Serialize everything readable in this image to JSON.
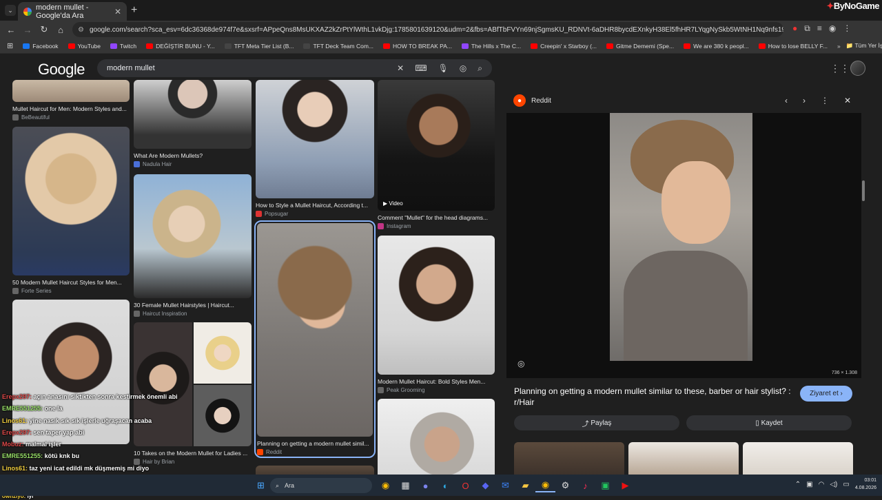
{
  "browser": {
    "tab_title": "modern mullet - Google'da Ara",
    "url": "google.com/search?sca_esv=6dc36368de974f7e&sxsrf=APpeQns8MsUKXAZ2kZrPtYlWthL1vkDjg:1785801639120&udm=2&fbs=ABfTbFVYn69njSgmsKU_RDNVt-6aDHR8bycdEXnkyH38El5fhHR7LYqgNySkb5WtNH1Nq9nfs197E1NJ0R3R...",
    "brand_overlay": "ByNoGame",
    "bookmarks": [
      {
        "label": "Facebook",
        "color": "#1877f2"
      },
      {
        "label": "YouTube",
        "color": "#ff0000"
      },
      {
        "label": "Twitch",
        "color": "#9146ff"
      },
      {
        "label": "DEĞİŞTİR BUNU - Y...",
        "color": "#ff0000"
      },
      {
        "label": "TFT Meta Tier List (B...",
        "color": "#444444"
      },
      {
        "label": "TFT Deck Team Com...",
        "color": "#444444"
      },
      {
        "label": "HOW TO BREAK PA...",
        "color": "#ff0000"
      },
      {
        "label": "The Hills x The C...",
        "color": "#9146ff"
      },
      {
        "label": "Creepin' x Starboy (...",
        "color": "#ff0000"
      },
      {
        "label": "Gitme Dememi (Spe...",
        "color": "#ff0000"
      },
      {
        "label": "We are 380 k peopl...",
        "color": "#ff0000"
      },
      {
        "label": "How to lose BELLY F...",
        "color": "#ff0000"
      }
    ],
    "all_bookmarks_label": "Tüm Yer İşaretleri"
  },
  "google": {
    "logo": "Google",
    "query": "modern mullet"
  },
  "results": {
    "col1": [
      {
        "caption": "Mullet Haircut for Men: Modern Styles and...",
        "source": "BeBeautiful"
      },
      {
        "caption": "50 Modern Mullet Haircut Styles for Men...",
        "source": "Forte Series"
      },
      {
        "caption": "",
        "source": ""
      }
    ],
    "col2": [
      {
        "caption": "What Are Modern Mullets?",
        "source": "Nadula Hair"
      },
      {
        "caption": "30 Female Mullet Hairstyles | Haircut...",
        "source": "Haircut Inspiration"
      },
      {
        "caption": "10 Takes on the Modern Mullet for Ladies ...",
        "source": "Hair by Brian"
      }
    ],
    "col3": [
      {
        "caption": "How to Style a Mullet Haircut, According t...",
        "source": "Popsugar"
      },
      {
        "caption": "Planning on getting a modern mullet simil...",
        "source": "Reddit"
      }
    ],
    "col4": [
      {
        "caption": "Comment \"Mullet\" for the head diagrams...",
        "source": "Instagram",
        "badge": "Video"
      },
      {
        "caption": "Modern Mullet Haircut: Bold Styles Men...",
        "source": "Peak Grooming"
      }
    ]
  },
  "panel": {
    "site": "Reddit",
    "dimensions": "736 × 1.308",
    "title": "Planning on getting a modern mullet similar to these, barber or hair stylist? : r/Hair",
    "visit_label": "Ziyaret et",
    "share_label": "Paylaş",
    "save_label": "Kaydet"
  },
  "chat": [
    {
      "user": "Erepx297:",
      "msg": "açın anasını siktikten sonra kestirmek önemli abi",
      "ucolor": "#e04a4a"
    },
    {
      "user": "EMRE551255:",
      "msg": "one la",
      "ucolor": "#9be26a"
    },
    {
      "user": "Linos61:",
      "msg": "yine nasık sık sık işlerle uğraşacan acaba",
      "ucolor": "#f4d03f"
    },
    {
      "user": "Erepx297:",
      "msg": "sen taper yap abi",
      "ucolor": "#e04a4a"
    },
    {
      "user": "Mobuz:",
      "msg": "malmal işler",
      "ucolor": "#e04a4a"
    },
    {
      "user": "EMRE551255:",
      "msg": "kötü knk bu",
      "ucolor": "#9be26a"
    },
    {
      "user": "Linos61:",
      "msg": "taz yeni icat edildi mk düşmemiş mi diyo",
      "ucolor": "#f4d03f"
    },
    {
      "user": "google a",
      "msg": "",
      "ucolor": "#ffffff"
    },
    {
      "user": "Çok nemli",
      "msg": "",
      "ucolor": "#ffffff"
    },
    {
      "user": "ownzlyo:",
      "msg": "iyi",
      "ucolor": "#f4d03f"
    }
  ],
  "taskbar": {
    "search_placeholder": "Ara",
    "time": "03:01",
    "date": "4.08.2026"
  }
}
